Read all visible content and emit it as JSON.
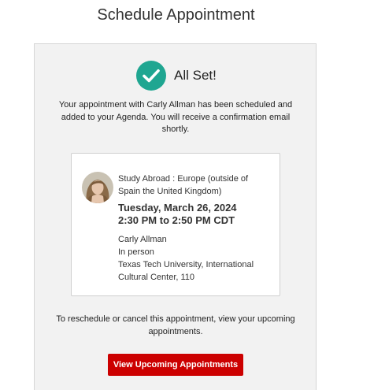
{
  "page": {
    "title": "Schedule Appointment"
  },
  "confirmation": {
    "status_text": "All Set!",
    "message": "Your appointment with Carly Allman has been scheduled and added to your Agenda. You will receive a confirmation email shortly.",
    "accent_color": "#1fa691"
  },
  "appointment": {
    "service": "Study Abroad : Europe (outside of Spain the United Kingdom)",
    "date": "Tuesday, March 26, 2024",
    "time": "2:30 PM to 2:50 PM CDT",
    "advisor": "Carly Allman",
    "meeting_type": "In person",
    "location": "Texas Tech University, International Cultural Center, 110"
  },
  "footer": {
    "message": "To reschedule or cancel this appointment, view your upcoming appointments.",
    "button_label": "View Upcoming Appointments",
    "button_color": "#cc0000"
  },
  "icons": {
    "status": "checkmark-icon",
    "avatar": "advisor-avatar"
  }
}
